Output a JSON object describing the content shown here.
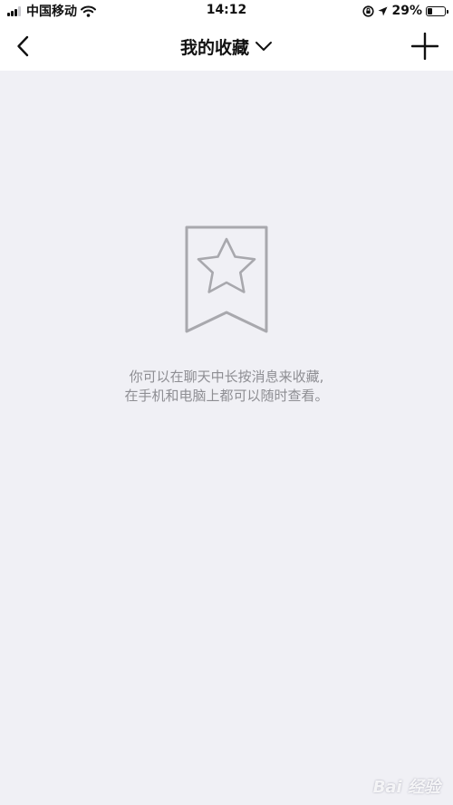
{
  "status_bar": {
    "carrier": "中国移动",
    "time": "14:12",
    "battery_percent": "29%",
    "battery_level": 0.29,
    "icons": [
      "signal-icon",
      "wifi-icon",
      "orientation-lock-icon",
      "location-arrow-icon",
      "battery-icon"
    ]
  },
  "nav_bar": {
    "title": "我的收藏",
    "back_icon": "chevron-left-icon",
    "dropdown_icon": "chevron-down-icon",
    "add_icon": "plus-icon"
  },
  "empty_state": {
    "icon": "bookmark-star-icon",
    "line1": "你可以在聊天中长按消息来收藏,",
    "line2": "在手机和电脑上都可以随时查看。"
  },
  "watermark": {
    "text": "Bai 经验"
  },
  "colors": {
    "background": "#f0f0f5",
    "bar": "#ffffff",
    "hint_text": "#8e8e93",
    "icon_gray": "#a8a8ad"
  }
}
